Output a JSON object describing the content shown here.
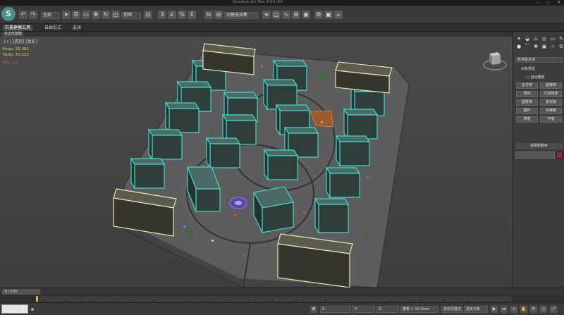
{
  "window": {
    "title": "Autodesk 3ds Max 2014 x64",
    "controls": [
      "–",
      "▭",
      "✕"
    ]
  },
  "toolbar": {
    "logo": "S",
    "undo_icon": "undo-icon",
    "redo_icon": "redo-icon",
    "selection_filter": "全部",
    "reference_coord": "视图",
    "named_selection": "创建选择集",
    "icons": [
      "link-icon",
      "unlink-icon",
      "bind-icon",
      "select-icon",
      "select-by-name-icon",
      "rect-select-icon",
      "window-crossing-icon",
      "move-icon",
      "rotate-icon",
      "scale-icon",
      "pivot-icon",
      "snap-icon",
      "angle-snap-icon",
      "percent-snap-icon",
      "spinner-snap-icon",
      "mirror-icon",
      "align-icon",
      "layer-icon",
      "graphite-icon",
      "curve-editor-icon",
      "schematic-icon",
      "material-editor-icon",
      "render-setup-icon",
      "render-frame-icon",
      "render-icon"
    ]
  },
  "ribbon": {
    "tabs": [
      "石墨建模工具",
      "自由形式",
      "选择"
    ],
    "active_tab": 0,
    "sub_tab": "多边形建模"
  },
  "viewport": {
    "label": "[+] [透视] [真实]",
    "stats": {
      "polys_label": "Polys:",
      "polys_value": "20,362",
      "verts_label": "Verts:",
      "verts_value": "10,323",
      "fps": "FPS: 0.0"
    },
    "accent": "#3fb8a8",
    "building_color": "#2f3d3b",
    "edge_color": "#40d8c4",
    "white_edge_color": "#e8e6b8"
  },
  "command_panel": {
    "tab_icons": [
      "create-icon",
      "modify-icon",
      "hierarchy-icon",
      "motion-icon",
      "display-icon",
      "utilities-icon"
    ],
    "category": "标准基本体",
    "rollout_title": "对象类型",
    "autogrid_label": "自动栅格",
    "buttons": [
      "长方体",
      "圆锥体",
      "球体",
      "几何球体",
      "圆柱体",
      "管状体",
      "圆环",
      "四棱锥",
      "茶壶",
      "平面"
    ],
    "name_rollout": "名称和颜色",
    "name_value": "",
    "object_color": "#9b1f49"
  },
  "timeline": {
    "frame_display": "0 / 100",
    "keyframe_color": "#d8b43a"
  },
  "statusbar": {
    "status_text": "",
    "x_label": "X:",
    "y_label": "Y:",
    "z_label": "Z:",
    "grid_label": "栅格 = 10.0mm",
    "auto_key": "自动关键点",
    "selected": "选定对象",
    "set_key": "设置关键点",
    "key_filters": "关键点过滤器..."
  }
}
